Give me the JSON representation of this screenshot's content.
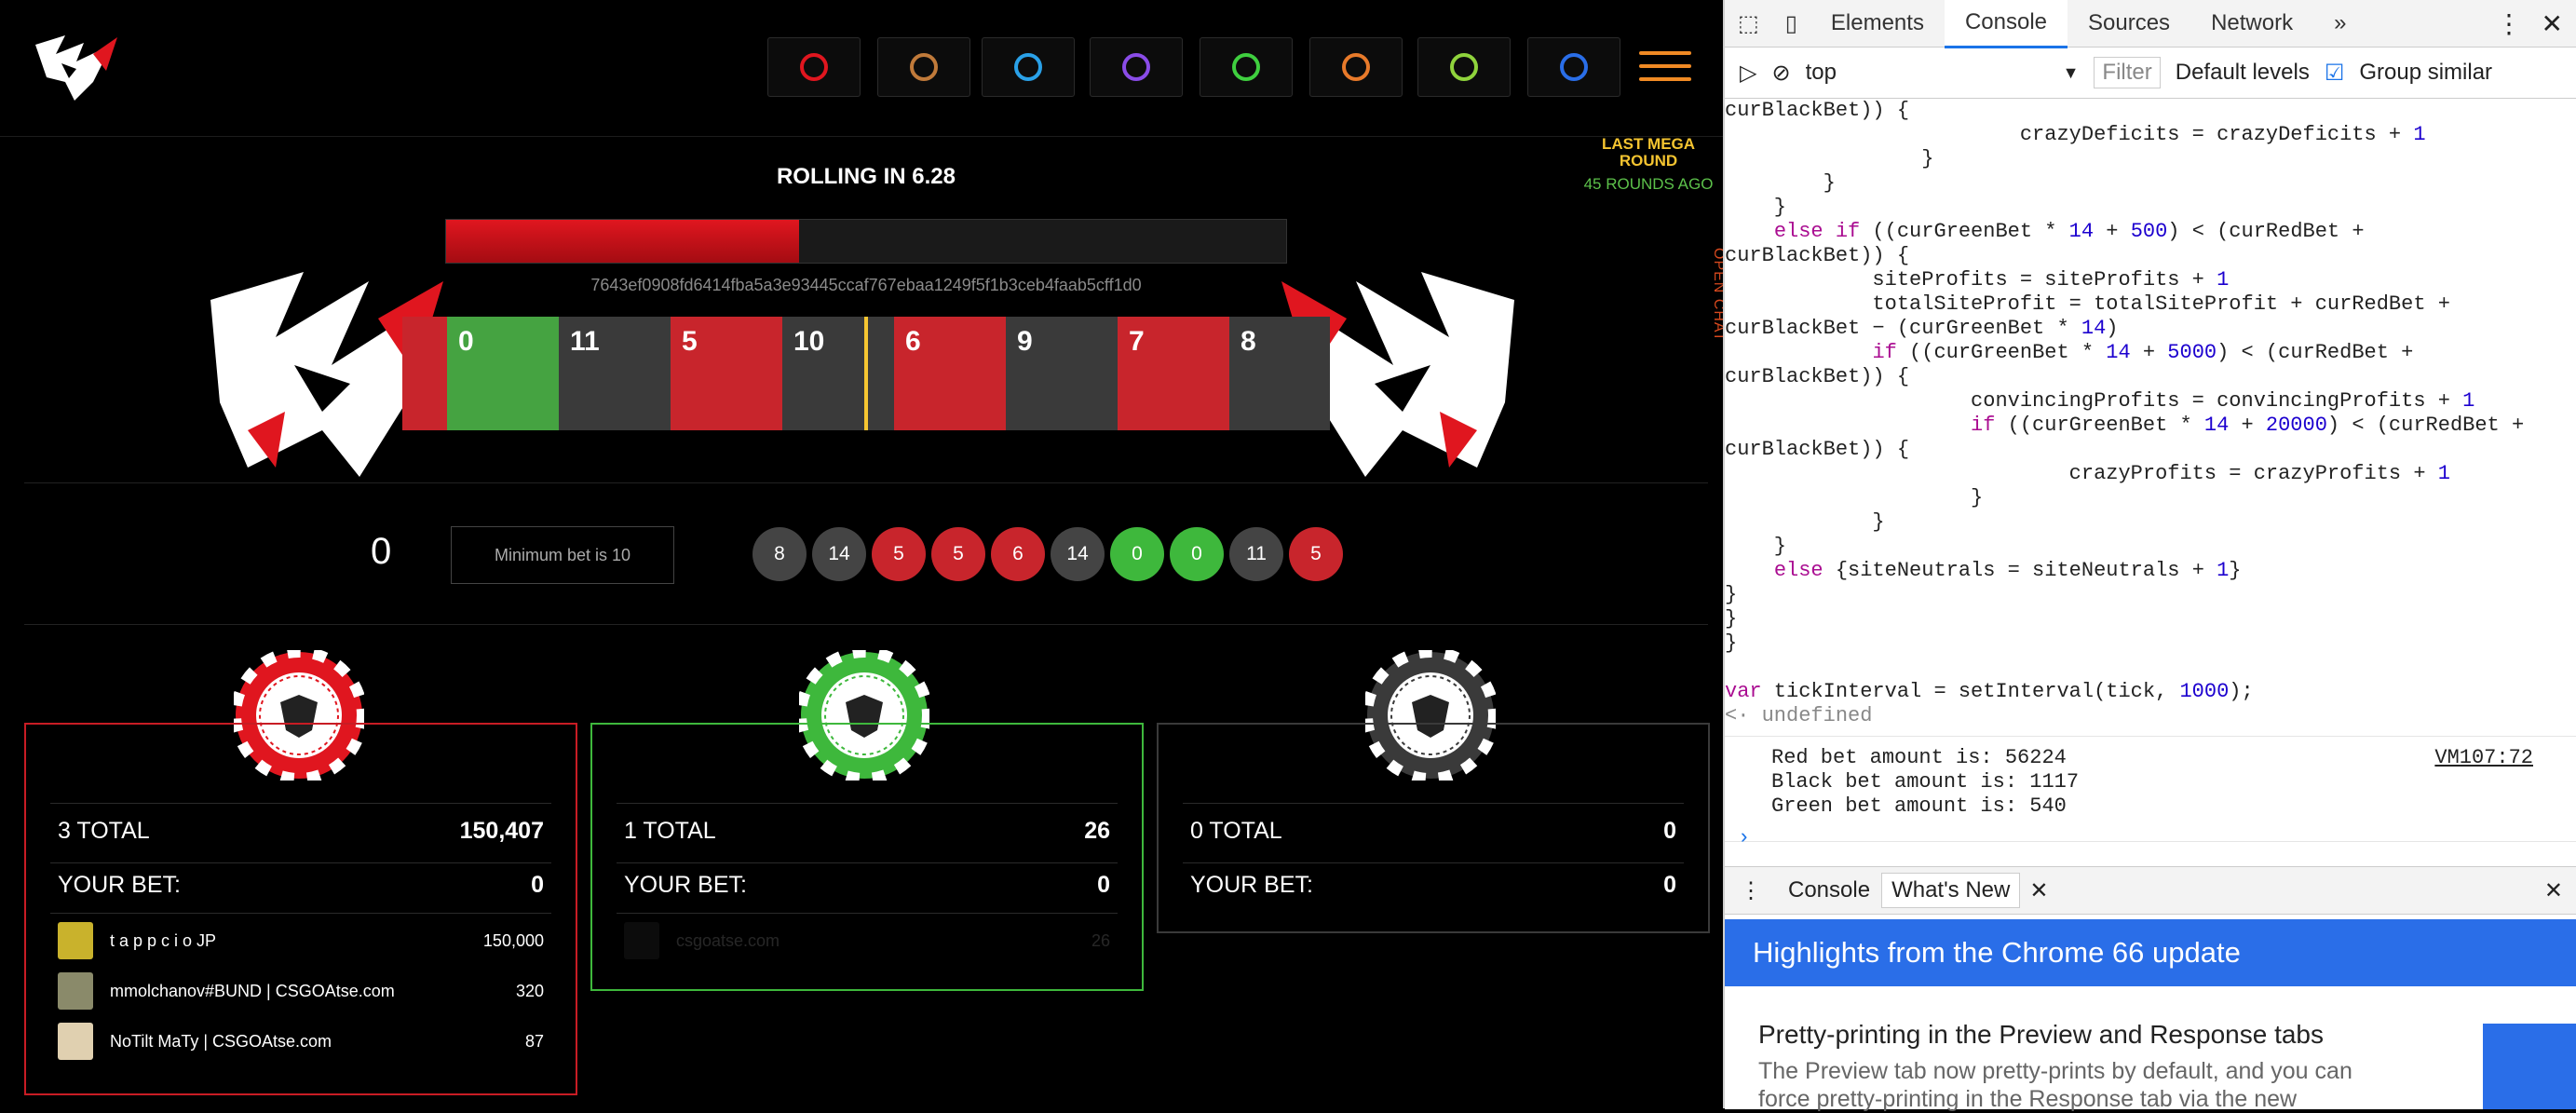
{
  "nav": {
    "icons": [
      "roulette-icon",
      "chart-icon",
      "cards-icon",
      "bomb-icon",
      "dice-icon",
      "speed-icon",
      "target-icon",
      "snowflake-icon"
    ],
    "colors": [
      "#e0161f",
      "#c07a3a",
      "#2aa1e8",
      "#8a4ce8",
      "#3fcf3f",
      "#e87a2a",
      "#8fd33c",
      "#2a6ee8"
    ]
  },
  "game": {
    "rolling": "ROLLING IN 6.28",
    "progress": 0.42,
    "hash": "7643ef0908fd6414fba5a3e93445ccaf767ebaa1249f5f1b3ceb4faab5cff1d0",
    "mega_title": "LAST MEGA ROUND",
    "mega_rounds": "45 ROUNDS AGO",
    "open_chat": "OPEN CHAT",
    "tiles": [
      {
        "n": "",
        "c": "red"
      },
      {
        "n": "0",
        "c": "green"
      },
      {
        "n": "11",
        "c": "black"
      },
      {
        "n": "5",
        "c": "red"
      },
      {
        "n": "10",
        "c": "black"
      },
      {
        "n": "6",
        "c": "red"
      },
      {
        "n": "9",
        "c": "black"
      },
      {
        "n": "7",
        "c": "red"
      },
      {
        "n": "8",
        "c": "black"
      }
    ],
    "balance": "0",
    "min_bet": "Minimum bet is 10",
    "history": [
      {
        "n": "8",
        "c": "black"
      },
      {
        "n": "14",
        "c": "black"
      },
      {
        "n": "5",
        "c": "red"
      },
      {
        "n": "5",
        "c": "red"
      },
      {
        "n": "6",
        "c": "red"
      },
      {
        "n": "14",
        "c": "black"
      },
      {
        "n": "0",
        "c": "green"
      },
      {
        "n": "0",
        "c": "green"
      },
      {
        "n": "11",
        "c": "black"
      },
      {
        "n": "5",
        "c": "red"
      }
    ]
  },
  "panels": {
    "red": {
      "total_label": "3 TOTAL",
      "total": "150,407",
      "your_label": "YOUR BET:",
      "your": "0",
      "bettors": [
        {
          "name": "t a p p c i o JP",
          "amount": "150,000"
        },
        {
          "name": "mmolchanov#BUND | CSGOAtse.com",
          "amount": "320"
        },
        {
          "name": "NoTilt MaTy | CSGOAtse.com",
          "amount": "87"
        }
      ]
    },
    "green": {
      "total_label": "1 TOTAL",
      "total": "26",
      "your_label": "YOUR BET:",
      "your": "0",
      "bettors": [
        {
          "name": "csgoatse.com",
          "amount": "26"
        }
      ]
    },
    "gray": {
      "total_label": "0 TOTAL",
      "total": "0",
      "your_label": "YOUR BET:",
      "your": "0"
    }
  },
  "devtools": {
    "tabs": [
      "Elements",
      "Console",
      "Sources",
      "Network"
    ],
    "context": "top",
    "filter_placeholder": "Filter",
    "levels": "Default levels",
    "group_similar": "Group similar",
    "prompt_result": "undefined",
    "log_source": "VM107:72",
    "logs": [
      "Red bet amount is: 56224",
      "Black bet amount is: 1117",
      "Green bet amount is: 540"
    ],
    "drawer_tabs": [
      "Console",
      "What's New"
    ],
    "highlights_title": "Highlights from the Chrome 66 update",
    "article_title": "Pretty-printing in the Preview and Response tabs",
    "article_body": "The Preview tab now pretty-prints by default, and you can force pretty-printing in the Response tab via the new"
  }
}
